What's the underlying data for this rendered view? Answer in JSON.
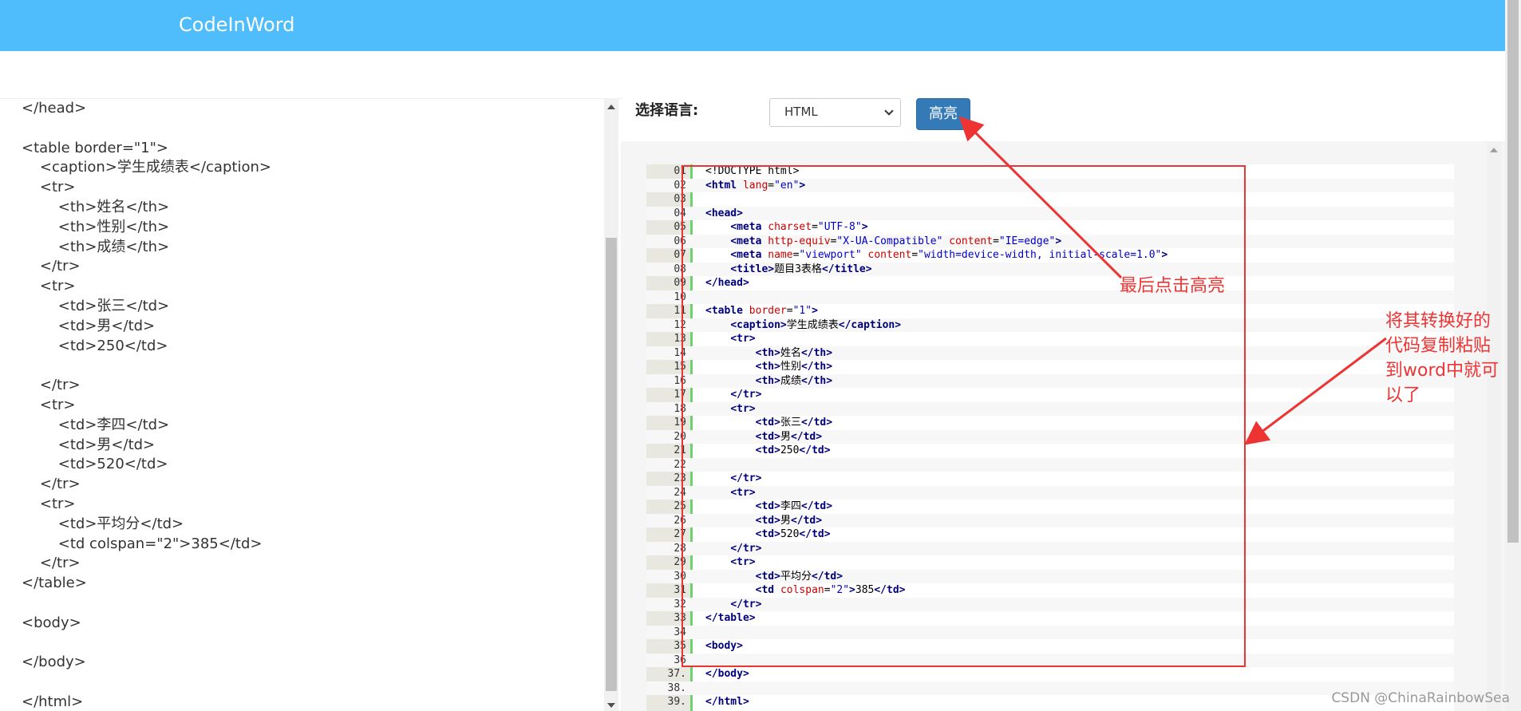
{
  "app": {
    "title": "CodeInWord"
  },
  "left_editor": {
    "lines": [
      "</head>",
      "",
      "<table border=\"1\">",
      "    <caption>学生成绩表</caption>",
      "    <tr>",
      "        <th>姓名</th>",
      "        <th>性别</th>",
      "        <th>成绩</th>",
      "    </tr>",
      "    <tr>",
      "        <td>张三</td>",
      "        <td>男</td>",
      "        <td>250</td>",
      "",
      "    </tr>",
      "    <tr>",
      "        <td>李四</td>",
      "        <td>男</td>",
      "        <td>520</td>",
      "    </tr>",
      "    <tr>",
      "        <td>平均分</td>",
      "        <td colspan=\"2\">385</td>",
      "    </tr>",
      "</table>",
      "",
      "<body>",
      "",
      "</body>",
      "",
      "</html>"
    ]
  },
  "controls": {
    "language_label": "选择语言:",
    "language_selected": "HTML",
    "highlight_button": "高亮"
  },
  "code_output": {
    "rows": [
      {
        "ln": "01",
        "code": [
          [
            "plain",
            "<!DOCTYPE html>"
          ]
        ]
      },
      {
        "ln": "02",
        "code": [
          [
            "tag",
            "<html "
          ],
          [
            "attr",
            "lang"
          ],
          [
            "plain",
            "="
          ],
          [
            "str",
            "\"en\""
          ],
          [
            "tag",
            ">"
          ]
        ]
      },
      {
        "ln": "03",
        "code": []
      },
      {
        "ln": "04",
        "code": [
          [
            "tag",
            "<head>"
          ]
        ]
      },
      {
        "ln": "05",
        "code": [
          [
            "plain",
            "    "
          ],
          [
            "tag",
            "<meta "
          ],
          [
            "attr",
            "charset"
          ],
          [
            "plain",
            "="
          ],
          [
            "str",
            "\"UTF-8\""
          ],
          [
            "tag",
            ">"
          ]
        ]
      },
      {
        "ln": "06",
        "code": [
          [
            "plain",
            "    "
          ],
          [
            "tag",
            "<meta "
          ],
          [
            "attr",
            "http-equiv"
          ],
          [
            "plain",
            "="
          ],
          [
            "str",
            "\"X-UA-Compatible\" "
          ],
          [
            "attr",
            "content"
          ],
          [
            "plain",
            "="
          ],
          [
            "str",
            "\"IE=edge\""
          ],
          [
            "tag",
            ">"
          ]
        ]
      },
      {
        "ln": "07",
        "code": [
          [
            "plain",
            "    "
          ],
          [
            "tag",
            "<meta "
          ],
          [
            "attr",
            "name"
          ],
          [
            "plain",
            "="
          ],
          [
            "str",
            "\"viewport\" "
          ],
          [
            "attr",
            "content"
          ],
          [
            "plain",
            "="
          ],
          [
            "str",
            "\"width=device-width, initial-scale=1.0\""
          ],
          [
            "tag",
            ">"
          ]
        ]
      },
      {
        "ln": "08",
        "code": [
          [
            "plain",
            "    "
          ],
          [
            "tag",
            "<title>"
          ],
          [
            "plain",
            "题目3表格"
          ],
          [
            "tag",
            "</title>"
          ]
        ]
      },
      {
        "ln": "09",
        "code": [
          [
            "tag",
            "</head>"
          ]
        ]
      },
      {
        "ln": "10",
        "code": []
      },
      {
        "ln": "11",
        "code": [
          [
            "tag",
            "<table "
          ],
          [
            "attr",
            "border"
          ],
          [
            "plain",
            "="
          ],
          [
            "str",
            "\"1\""
          ],
          [
            "tag",
            ">"
          ]
        ]
      },
      {
        "ln": "12",
        "code": [
          [
            "plain",
            "    "
          ],
          [
            "tag",
            "<caption>"
          ],
          [
            "plain",
            "学生成绩表"
          ],
          [
            "tag",
            "</caption>"
          ]
        ]
      },
      {
        "ln": "13",
        "code": [
          [
            "plain",
            "    "
          ],
          [
            "tag",
            "<tr>"
          ]
        ]
      },
      {
        "ln": "14",
        "code": [
          [
            "plain",
            "        "
          ],
          [
            "tag",
            "<th>"
          ],
          [
            "plain",
            "姓名"
          ],
          [
            "tag",
            "</th>"
          ]
        ]
      },
      {
        "ln": "15",
        "code": [
          [
            "plain",
            "        "
          ],
          [
            "tag",
            "<th>"
          ],
          [
            "plain",
            "性别"
          ],
          [
            "tag",
            "</th>"
          ]
        ]
      },
      {
        "ln": "16",
        "code": [
          [
            "plain",
            "        "
          ],
          [
            "tag",
            "<th>"
          ],
          [
            "plain",
            "成绩"
          ],
          [
            "tag",
            "</th>"
          ]
        ]
      },
      {
        "ln": "17",
        "code": [
          [
            "plain",
            "    "
          ],
          [
            "tag",
            "</tr>"
          ]
        ]
      },
      {
        "ln": "18",
        "code": [
          [
            "plain",
            "    "
          ],
          [
            "tag",
            "<tr>"
          ]
        ]
      },
      {
        "ln": "19",
        "code": [
          [
            "plain",
            "        "
          ],
          [
            "tag",
            "<td>"
          ],
          [
            "plain",
            "张三"
          ],
          [
            "tag",
            "</td>"
          ]
        ]
      },
      {
        "ln": "20",
        "code": [
          [
            "plain",
            "        "
          ],
          [
            "tag",
            "<td>"
          ],
          [
            "plain",
            "男"
          ],
          [
            "tag",
            "</td>"
          ]
        ]
      },
      {
        "ln": "21",
        "code": [
          [
            "plain",
            "        "
          ],
          [
            "tag",
            "<td>"
          ],
          [
            "plain",
            "250"
          ],
          [
            "tag",
            "</td>"
          ]
        ]
      },
      {
        "ln": "22",
        "code": []
      },
      {
        "ln": "23",
        "code": [
          [
            "plain",
            "    "
          ],
          [
            "tag",
            "</tr>"
          ]
        ]
      },
      {
        "ln": "24",
        "code": [
          [
            "plain",
            "    "
          ],
          [
            "tag",
            "<tr>"
          ]
        ]
      },
      {
        "ln": "25",
        "code": [
          [
            "plain",
            "        "
          ],
          [
            "tag",
            "<td>"
          ],
          [
            "plain",
            "李四"
          ],
          [
            "tag",
            "</td>"
          ]
        ]
      },
      {
        "ln": "26",
        "code": [
          [
            "plain",
            "        "
          ],
          [
            "tag",
            "<td>"
          ],
          [
            "plain",
            "男"
          ],
          [
            "tag",
            "</td>"
          ]
        ]
      },
      {
        "ln": "27",
        "code": [
          [
            "plain",
            "        "
          ],
          [
            "tag",
            "<td>"
          ],
          [
            "plain",
            "520"
          ],
          [
            "tag",
            "</td>"
          ]
        ]
      },
      {
        "ln": "28",
        "code": [
          [
            "plain",
            "    "
          ],
          [
            "tag",
            "</tr>"
          ]
        ]
      },
      {
        "ln": "29",
        "code": [
          [
            "plain",
            "    "
          ],
          [
            "tag",
            "<tr>"
          ]
        ]
      },
      {
        "ln": "30",
        "code": [
          [
            "plain",
            "        "
          ],
          [
            "tag",
            "<td>"
          ],
          [
            "plain",
            "平均分"
          ],
          [
            "tag",
            "</td>"
          ]
        ]
      },
      {
        "ln": "31",
        "code": [
          [
            "plain",
            "        "
          ],
          [
            "tag",
            "<td "
          ],
          [
            "attr",
            "colspan"
          ],
          [
            "plain",
            "="
          ],
          [
            "str",
            "\"2\""
          ],
          [
            "tag",
            ">"
          ],
          [
            "plain",
            "385"
          ],
          [
            "tag",
            "</td>"
          ]
        ]
      },
      {
        "ln": "32",
        "code": [
          [
            "plain",
            "    "
          ],
          [
            "tag",
            "</tr>"
          ]
        ]
      },
      {
        "ln": "33",
        "code": [
          [
            "tag",
            "</table>"
          ]
        ]
      },
      {
        "ln": "34",
        "code": []
      },
      {
        "ln": "35",
        "code": [
          [
            "tag",
            "<body>"
          ]
        ]
      },
      {
        "ln": "36",
        "code": []
      },
      {
        "ln": "37.",
        "code": [
          [
            "tag",
            "</body>"
          ]
        ]
      },
      {
        "ln": "38.",
        "code": []
      },
      {
        "ln": "39.",
        "code": [
          [
            "tag",
            "</html>"
          ]
        ]
      }
    ]
  },
  "annotations": {
    "click_highlight": "最后点击高亮",
    "copy_note": [
      "将其转换好的",
      "代码复制粘贴",
      "到word中就可",
      "以了"
    ],
    "color": "#ee3333"
  },
  "watermark": "CSDN @ChinaRainbowSea"
}
